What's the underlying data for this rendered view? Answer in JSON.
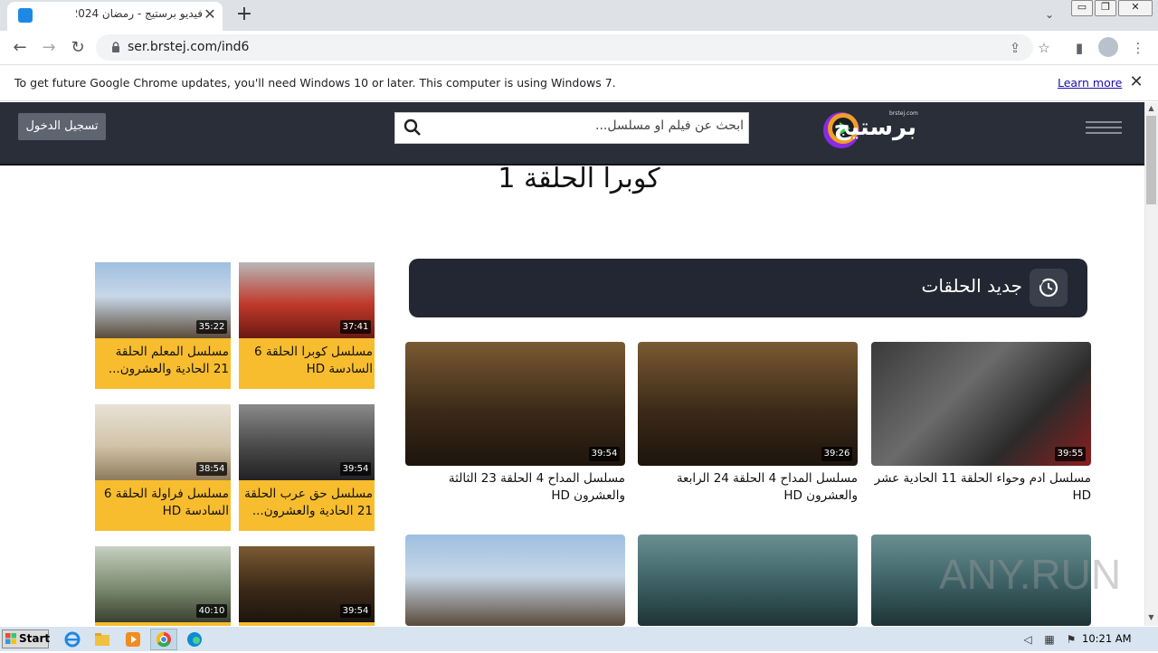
{
  "browser": {
    "tab_title": "فيديو برستيج - رمضان 2024",
    "url": "ser.brstej.com/ind6",
    "infobar_text": "To get future Google Chrome updates, you'll need Windows 10 or later. This computer is using Windows 7.",
    "infobar_link": "Learn more"
  },
  "site": {
    "logo_text": "برستيج",
    "logo_domain": "brstej.com",
    "login_label": "تسجيل الدخول",
    "search_placeholder": "ابحث عن فيلم او مسلسل...",
    "page_title": "كوبرا الحلقة 1",
    "section_title": "جديد الحلقات",
    "episodes": [
      {
        "title": "مسلسل ادم وحواء الحلقة 11 الحادية عشر HD",
        "duration": "39:55",
        "thumb": "dark-red"
      },
      {
        "title": "مسلسل المداح 4 الحلقة 24 الرابعة والعشرون HD",
        "duration": "39:26",
        "thumb": "sepia"
      },
      {
        "title": "مسلسل المداح 4 الحلقة 23 الثالثة والعشرون HD",
        "duration": "39:54",
        "thumb": "sepia"
      },
      {
        "title": "",
        "duration": "",
        "thumb": "teal"
      },
      {
        "title": "",
        "duration": "",
        "thumb": "teal"
      },
      {
        "title": "",
        "duration": "",
        "thumb": "blue-sky"
      }
    ],
    "sidebar": [
      {
        "title": "مسلسل كوبرا الحلقة 6 السادسة HD",
        "duration": "37:41",
        "thumb": "red"
      },
      {
        "title": "مسلسل المعلم الحلقة 21 الحادية والعشرون...",
        "duration": "35:22",
        "thumb": "blue-sky"
      },
      {
        "title": "مسلسل حق عرب الحلقة 21 الحادية والعشرون...",
        "duration": "39:54",
        "thumb": "grey"
      },
      {
        "title": "مسلسل فراولة الحلقة 6 السادسة HD",
        "duration": "38:54",
        "thumb": "light"
      },
      {
        "title": "",
        "duration": "39:54",
        "thumb": "sepia"
      },
      {
        "title": "",
        "duration": "40:10",
        "thumb": "green"
      }
    ]
  },
  "taskbar": {
    "start_label": "Start",
    "clock": "10:21 AM"
  },
  "watermark": "ANY.RUN",
  "colors": {
    "header_bg": "#2a2e39",
    "section_bg": "#232733",
    "card_yellow": "#f7bd2e",
    "logo_purple": "#8a2be2"
  }
}
